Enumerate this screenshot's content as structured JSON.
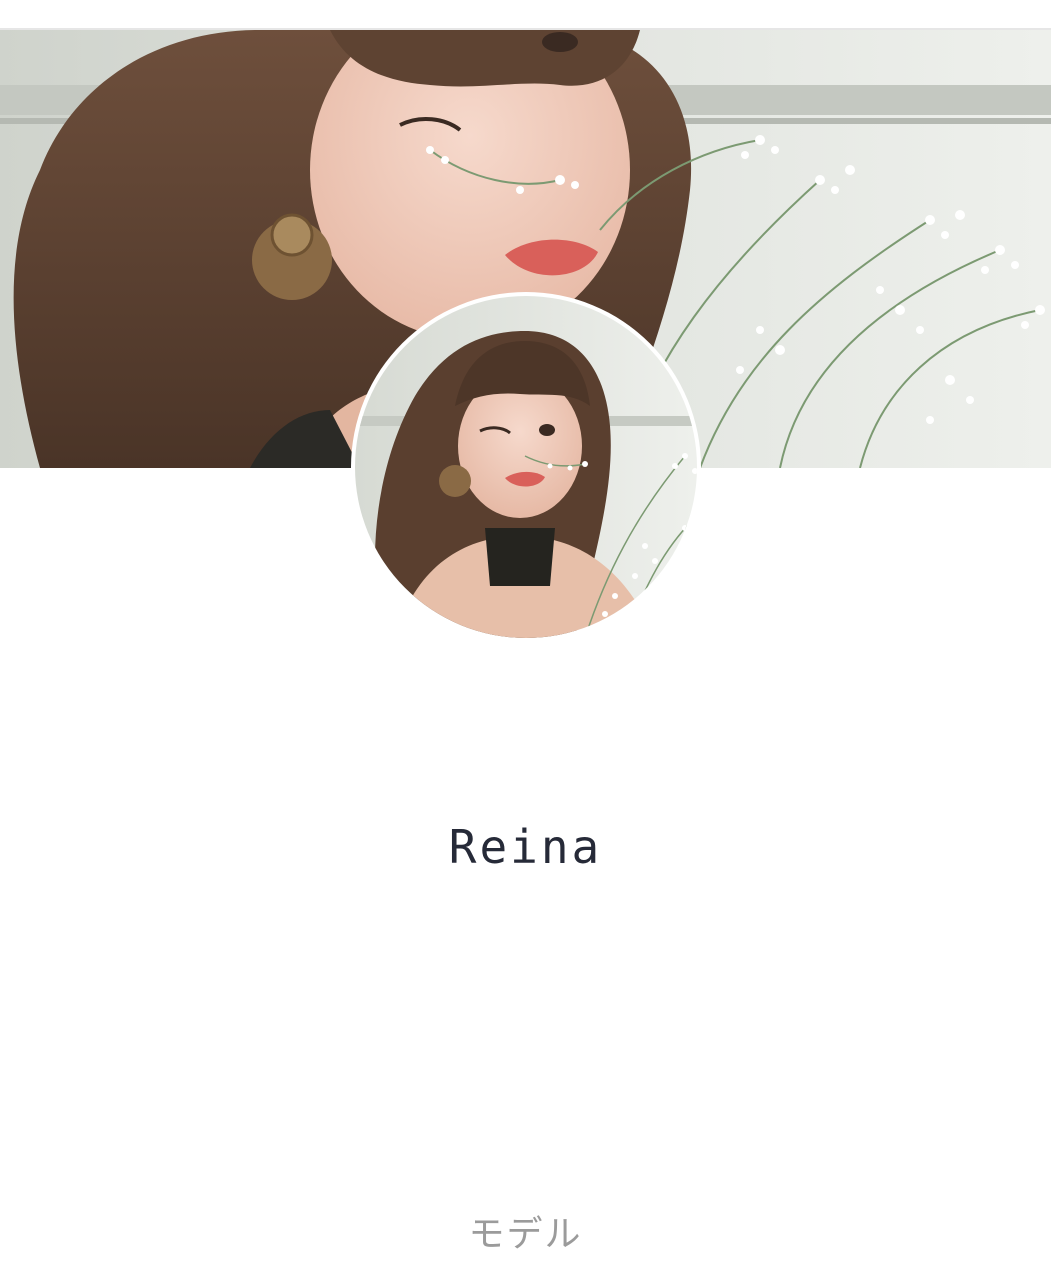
{
  "profile": {
    "name": "Reina",
    "occupation": "モデル"
  },
  "images": {
    "cover": "cover-photo-woman-with-baby-breath-flowers",
    "avatar": "profile-photo-woman-winking-with-flowers"
  },
  "colors": {
    "name_text": "#262a38",
    "occupation_text": "#9b9b9b",
    "background": "#ffffff"
  }
}
